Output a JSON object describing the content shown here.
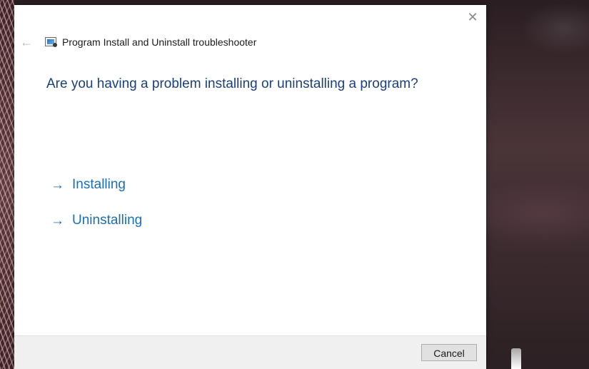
{
  "window": {
    "title": "Program Install and Uninstall troubleshooter",
    "close_icon": "close-icon",
    "back_icon": "back-arrow-icon"
  },
  "main": {
    "question": "Are you having a problem installing or uninstalling a program?",
    "options": [
      {
        "label": "Installing",
        "icon": "arrow-right-icon"
      },
      {
        "label": "Uninstalling",
        "icon": "arrow-right-icon"
      }
    ]
  },
  "footer": {
    "cancel_label": "Cancel"
  },
  "colors": {
    "question": "#1a3f7c",
    "link": "#1a6fb3",
    "footer_bg": "#f0f0f0"
  }
}
